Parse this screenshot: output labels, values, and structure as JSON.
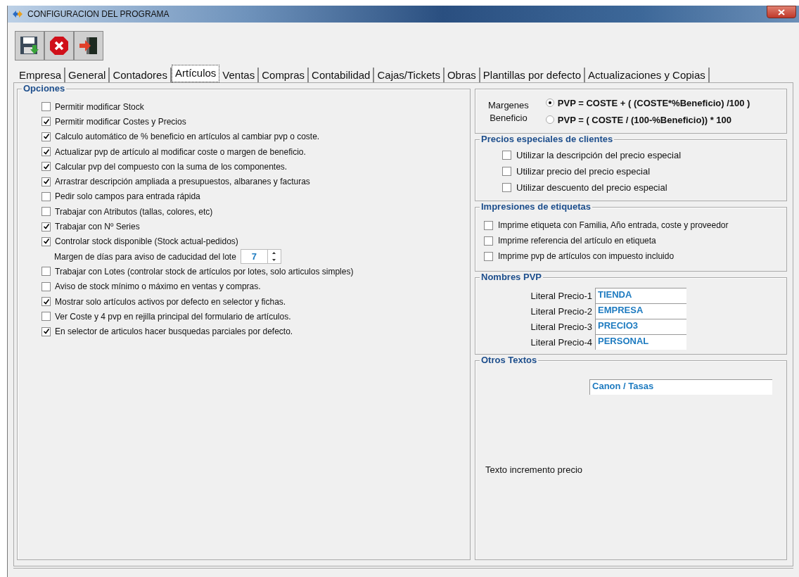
{
  "window": {
    "title": "CONFIGURACION DEL PROGRAMA"
  },
  "toolbar": [
    {
      "kind": "save"
    },
    {
      "kind": "cancel"
    },
    {
      "kind": "exit"
    }
  ],
  "tabs": [
    {
      "label": "Empresa",
      "selected": false
    },
    {
      "label": "General",
      "selected": false
    },
    {
      "label": "Contadores",
      "selected": false
    },
    {
      "label": "Artículos",
      "selected": true
    },
    {
      "label": "Ventas",
      "selected": false
    },
    {
      "label": "Compras",
      "selected": false
    },
    {
      "label": "Contabilidad",
      "selected": false
    },
    {
      "label": "Cajas/Tickets",
      "selected": false
    },
    {
      "label": "Obras",
      "selected": false
    },
    {
      "label": "Plantillas por defecto",
      "selected": false
    },
    {
      "label": "Actualizaciones y Copias",
      "selected": false
    }
  ],
  "opciones": {
    "title": "Opciones",
    "items": [
      {
        "kind": "checkbox",
        "label": "Permitir modificar Stock",
        "checked": false
      },
      {
        "kind": "checkbox",
        "label": "Permitir modificar Costes y Precios",
        "checked": true
      },
      {
        "kind": "checkbox",
        "label": "Calculo automático de % beneficio en artículos al cambiar pvp o coste.",
        "checked": true
      },
      {
        "kind": "checkbox",
        "label": "Actualizar pvp de artículo al modificar coste o margen de beneficio.",
        "checked": true
      },
      {
        "kind": "checkbox",
        "label": "Calcular pvp del compuesto con la suma de los componentes.",
        "checked": true
      },
      {
        "kind": "checkbox",
        "label": "Arrastrar descripción ampliada a presupuestos, albaranes y facturas",
        "checked": true
      },
      {
        "kind": "checkbox",
        "label": "Pedir solo campos para entrada rápida",
        "checked": false
      },
      {
        "kind": "checkbox",
        "label": "Trabajar con Atributos (tallas, colores, etc)",
        "checked": false
      },
      {
        "kind": "checkbox",
        "label": "Trabajar con Nº Series",
        "checked": true
      },
      {
        "kind": "checkbox",
        "label": "Controlar stock disponible (Stock actual-pedidos)",
        "checked": true
      },
      {
        "kind": "spinner",
        "label": "Margen de días para aviso de caducidad del lote",
        "value": "7"
      },
      {
        "kind": "checkbox",
        "label": "Trabajar con Lotes (controlar stock de artículos por lotes, solo articulos simples)",
        "checked": false
      },
      {
        "kind": "checkbox",
        "label": "Aviso de stock mínimo o máximo en ventas y compras.",
        "checked": false
      },
      {
        "kind": "checkbox",
        "label": "Mostrar solo artículos activos por defecto en selector y fichas.",
        "checked": true
      },
      {
        "kind": "checkbox",
        "label": "Ver Coste y 4 pvp en rejilla principal del formulario de artículos.",
        "checked": false
      },
      {
        "kind": "checkbox",
        "label": "En selector de articulos hacer busquedas parciales por defecto.",
        "checked": true
      }
    ]
  },
  "margenes": {
    "label_1": "Margenes",
    "label_2": "Beneficio",
    "options": [
      {
        "label": "PVP = COSTE + ( (COSTE*%Beneficio) /100 )",
        "selected": true
      },
      {
        "label": "PVP = ( COSTE / (100-%Beneficio)) * 100",
        "selected": false
      }
    ]
  },
  "precios_especiales": {
    "title": "Precios especiales de clientes",
    "items": [
      {
        "label": "Utilizar la descripción del precio especial",
        "checked": false
      },
      {
        "label": "Utilizar precio del precio especial",
        "checked": false
      },
      {
        "label": "Utilizar descuento del precio especial",
        "checked": false
      }
    ]
  },
  "impresiones": {
    "title": "Impresiones de etiquetas",
    "items": [
      {
        "label": "Imprime etiqueta con Familia, Año entrada, coste y proveedor",
        "checked": false
      },
      {
        "label": "Imprime referencia del artículo en etiqueta",
        "checked": false
      },
      {
        "label": "Imprime pvp de artículos con impuesto incluido",
        "checked": false
      }
    ]
  },
  "nombres_pvp": {
    "title": "Nombres PVP",
    "fields": [
      {
        "label": "Literal Precio-1",
        "value": "TIENDA"
      },
      {
        "label": "Literal Precio-2",
        "value": "EMPRESA"
      },
      {
        "label": "Literal Precio-3",
        "value": "PRECIO3"
      },
      {
        "label": "Literal Precio-4",
        "value": "PERSONAL"
      }
    ]
  },
  "otros_textos": {
    "title": "Otros Textos",
    "fields": [
      {
        "label": "Texto incremento precio",
        "value": "Canon / Tasas"
      }
    ]
  }
}
